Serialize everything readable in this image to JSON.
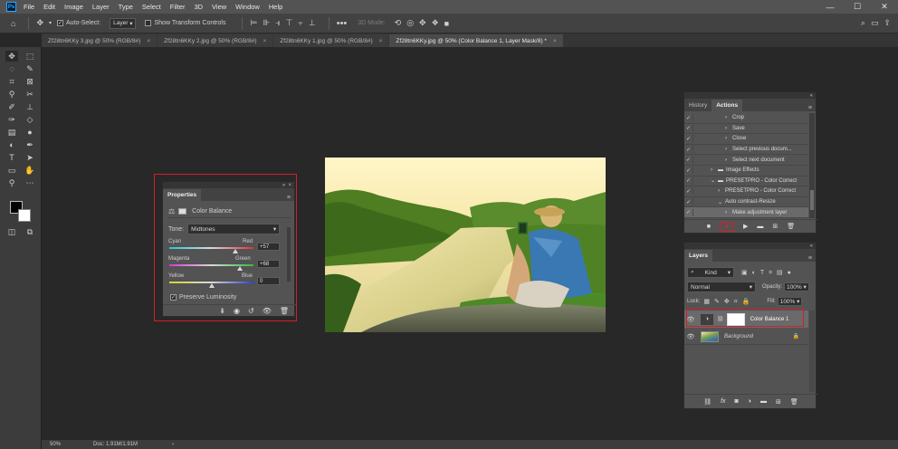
{
  "app": {
    "logo": "Ps"
  },
  "menu": [
    "File",
    "Edit",
    "Image",
    "Layer",
    "Type",
    "Select",
    "Filter",
    "3D",
    "View",
    "Window",
    "Help"
  ],
  "window_controls": {
    "minimize": "—",
    "maximize": "☐",
    "close": "✕"
  },
  "options_bar": {
    "auto_select_label": "Auto-Select:",
    "auto_select_checked": true,
    "target_value": "Layer",
    "transform_label": "Show Transform Controls",
    "mode_3d_label": "3D Mode:"
  },
  "tabs": [
    {
      "label": "Zf28tn6KKy 3.jpg @ 50% (RGB/8#)",
      "active": false
    },
    {
      "label": "Zf28tn6KKy 2.jpg @ 50% (RGB/8#)",
      "active": false
    },
    {
      "label": "Zf28tn6KKy 1.jpg @ 50% (RGB/8#)",
      "active": false
    },
    {
      "label": "Zf28tn6KKy.jpg @ 50% (Color Balance 1, Layer Mask/8) *",
      "active": true
    }
  ],
  "properties": {
    "tab_label": "Properties",
    "adjustment_name": "Color Balance",
    "tone_label": "Tone:",
    "tone_value": "Midtones",
    "sliders": [
      {
        "left": "Cyan",
        "right": "Red",
        "value": "+57",
        "position": 0.785
      },
      {
        "left": "Magenta",
        "right": "Green",
        "value": "+68",
        "position": 0.84
      },
      {
        "left": "Yellow",
        "right": "Blue",
        "value": "0",
        "position": 0.5
      }
    ],
    "preserve_luminosity_label": "Preserve Luminosity",
    "preserve_luminosity_checked": true
  },
  "actions_panel": {
    "tabs": [
      "History",
      "Actions"
    ],
    "active_tab": "Actions",
    "rows": [
      {
        "label": "Crop",
        "indent": 3
      },
      {
        "label": "Save",
        "indent": 3
      },
      {
        "label": "Close",
        "indent": 3
      },
      {
        "label": "Select previous docum...",
        "indent": 3
      },
      {
        "label": "Select next document",
        "indent": 3
      },
      {
        "label": "Image Effects",
        "indent": 1,
        "folder": true
      },
      {
        "label": "PRESETPRO - Color Correct",
        "indent": 1,
        "folder": true,
        "open": true
      },
      {
        "label": "PRESETPRO - Color Correct",
        "indent": 2
      },
      {
        "label": "Auto contrast-Resize",
        "indent": 2,
        "open": true
      },
      {
        "label": "Make adjustment layer",
        "indent": 3
      }
    ]
  },
  "layers_panel": {
    "tab_label": "Layers",
    "filter_value": "Kind",
    "blend_mode": "Normal",
    "opacity_label": "Opacity:",
    "opacity_value": "100%",
    "lock_label": "Lock:",
    "fill_label": "Fill:",
    "fill_value": "100%",
    "layers": [
      {
        "name": "Color Balance 1",
        "type": "adjustment",
        "selected": true
      },
      {
        "name": "Background",
        "type": "image",
        "locked": true
      }
    ]
  },
  "status": {
    "zoom": "50%",
    "doc_info": "Doc: 1.91M/1.91M"
  },
  "colors": {
    "accent_red": "#d0202b",
    "record_red": "#e0222c",
    "ps_blue": "#31a8ff"
  }
}
